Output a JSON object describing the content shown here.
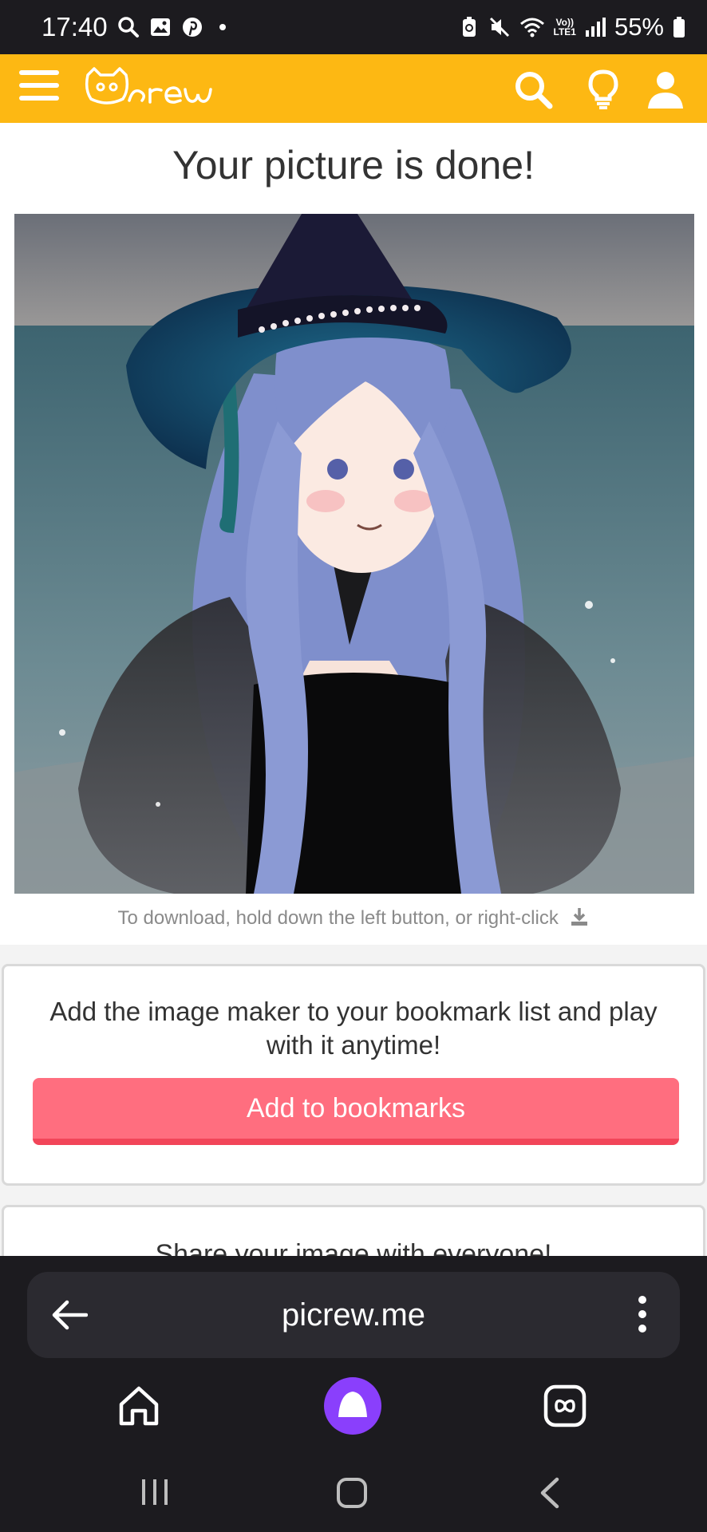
{
  "status_bar": {
    "time": "17:40",
    "battery": "55%",
    "network_top": "Vo))",
    "network_bottom": "LTE1"
  },
  "header": {
    "logo_text": "Picrew",
    "menu_icon": "hamburger-menu-icon",
    "search_icon": "search-icon",
    "hint_icon": "lightbulb-icon",
    "account_icon": "user-icon",
    "brand_color": "#fdb813"
  },
  "main": {
    "title": "Your picture is done!",
    "download_hint": "To download, hold down the left button, or right-click",
    "download_icon": "download-icon"
  },
  "bookmark_card": {
    "text": "Add the image maker to your bookmark list and play with it anytime!",
    "button_label": "Add to bookmarks",
    "button_color": "#ff6e7f"
  },
  "share_card": {
    "text": "Share your image with everyone!"
  },
  "browser": {
    "url": "picrew.me",
    "back_icon": "arrow-left-icon",
    "more_icon": "more-vertical-icon",
    "home_icon": "home-icon",
    "assistant_icon": "assistant-icon",
    "tabs_icon": "tabs-icon"
  },
  "system_nav": {
    "recents_icon": "recents-icon",
    "home_icon": "home-circle-icon",
    "back_icon": "back-chevron-icon"
  }
}
